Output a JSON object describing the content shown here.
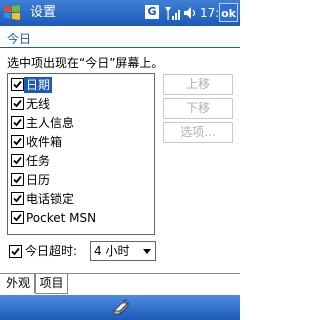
{
  "status_bar": {
    "title": "设置",
    "network_badge": "G",
    "time": "17:47",
    "ok_label": "ok",
    "icons": [
      "windows-start-icon",
      "signal-icon",
      "volume-icon"
    ]
  },
  "page": {
    "heading": "今日",
    "instruction": "选中项出现在“今日”屏幕上。"
  },
  "list": {
    "items": [
      {
        "label": "日期",
        "checked": true,
        "selected": true
      },
      {
        "label": "无线",
        "checked": true,
        "selected": false
      },
      {
        "label": "主人信息",
        "checked": true,
        "selected": false
      },
      {
        "label": "收件箱",
        "checked": true,
        "selected": false
      },
      {
        "label": "任务",
        "checked": true,
        "selected": false
      },
      {
        "label": "日历",
        "checked": true,
        "selected": false
      },
      {
        "label": "电话锁定",
        "checked": true,
        "selected": false
      },
      {
        "label": "Pocket MSN",
        "checked": true,
        "selected": false
      }
    ]
  },
  "buttons": {
    "move_up": "上移",
    "move_down": "下移",
    "options": "选项..."
  },
  "timeout": {
    "label": "今日超时:",
    "value": "4 小时",
    "checked": true
  },
  "tabs": [
    {
      "label": "外观",
      "active": false
    },
    {
      "label": "项目",
      "active": true
    }
  ],
  "colors": {
    "accent": "#1b5ab8",
    "title_bar": "#1b5ab8",
    "disabled_text": "#b0b0b0"
  },
  "bottom_bar": {
    "icon": "keyboard-icon"
  }
}
